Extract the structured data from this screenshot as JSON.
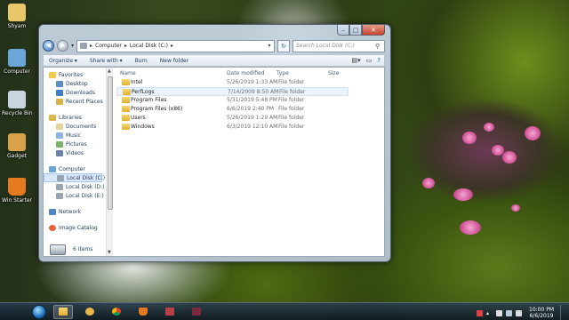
{
  "desktop": {
    "icons": [
      {
        "label": "Shyam",
        "color": "#e8c66a"
      },
      {
        "label": "Computer",
        "color": "#6aa6d8"
      },
      {
        "label": "Recycle Bin",
        "color": "#c9d4de"
      },
      {
        "label": "Gadget",
        "color": "#d8a24a"
      },
      {
        "label": "Win Starter",
        "color": "#e57a1e"
      }
    ]
  },
  "window": {
    "caption_buttons": {
      "minimize": "–",
      "maximize": "□",
      "close": "✕"
    },
    "nav": {
      "back": "◀",
      "forward": "▶",
      "recent": "▾"
    },
    "address": [
      "Computer",
      "Local Disk (C:)"
    ],
    "search_placeholder": "Search Local Disk (C:)",
    "toolbar": {
      "organize": "Organize ▾",
      "share": "Share with ▾",
      "burn": "Burn",
      "new_folder": "New folder"
    },
    "sidebar": {
      "favorites": "Favorites",
      "favorite_items": [
        "Desktop",
        "Downloads",
        "Recent Places"
      ],
      "libraries": "Libraries",
      "library_items": [
        "Documents",
        "Music",
        "Pictures",
        "Videos"
      ],
      "computer": "Computer",
      "computer_items": [
        "Local Disk (C:)",
        "Local Disk (D:)",
        "Local Disk (E:)"
      ],
      "network": "Network",
      "image_catalog": "Image Catalog"
    },
    "columns": {
      "name": "Name",
      "date": "Date modified",
      "type": "Type",
      "size": "Size"
    },
    "files": [
      {
        "name": "Intel",
        "date": "5/26/2019 1:33 AM",
        "type": "File folder"
      },
      {
        "name": "PerfLogs",
        "date": "7/14/2009 8:50 AM",
        "type": "File folder"
      },
      {
        "name": "Program Files",
        "date": "5/31/2019 5:48 PM",
        "type": "File folder"
      },
      {
        "name": "Program Files (x86)",
        "date": "6/6/2019 2:40 PM",
        "type": "File folder"
      },
      {
        "name": "Users",
        "date": "5/26/2019 1:29 AM",
        "type": "File folder"
      },
      {
        "name": "Windows",
        "date": "6/3/2019 12:10 AM",
        "type": "File folder"
      }
    ],
    "status": "6 items"
  },
  "taskbar": {
    "clock_time": "10:00 PM",
    "clock_date": "6/6/2019"
  }
}
